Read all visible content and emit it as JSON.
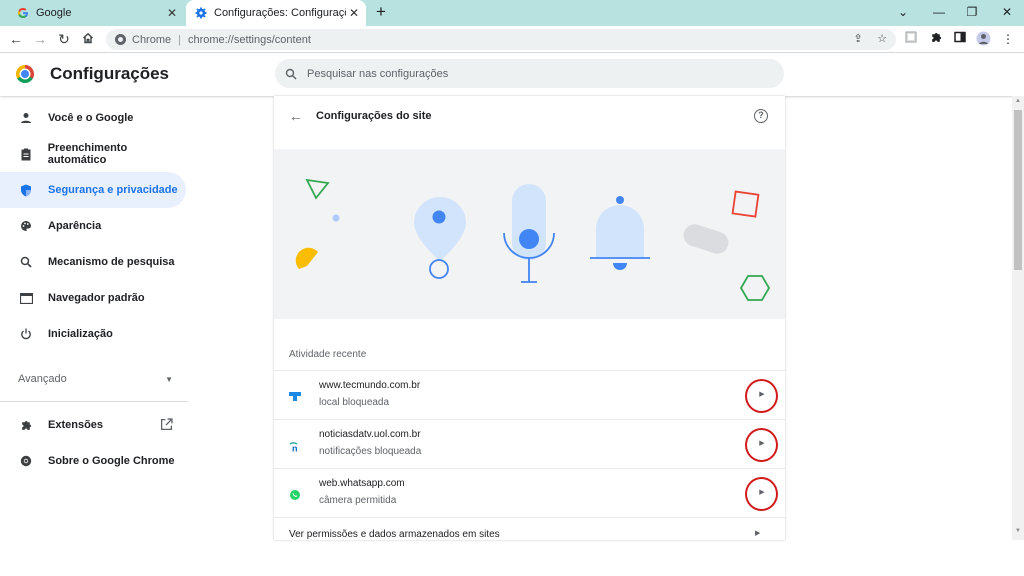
{
  "tabs": [
    {
      "title": "Google",
      "favicon": "google-g-icon"
    },
    {
      "title": "Configurações: Configurações do site",
      "favicon": "settings-gear-icon"
    }
  ],
  "omnibox": {
    "chip": "Chrome",
    "url": "chrome://settings/content"
  },
  "header": {
    "title": "Configurações",
    "search_placeholder": "Pesquisar nas configurações"
  },
  "sidebar": {
    "items": [
      {
        "label": "Você e o Google",
        "icon": "person-icon"
      },
      {
        "label": "Preenchimento automático",
        "icon": "clipboard-icon"
      },
      {
        "label": "Segurança e privacidade",
        "icon": "shield-icon"
      },
      {
        "label": "Aparência",
        "icon": "palette-icon"
      },
      {
        "label": "Mecanismo de pesquisa",
        "icon": "search-icon"
      },
      {
        "label": "Navegador padrão",
        "icon": "browser-window-icon"
      },
      {
        "label": "Inicialização",
        "icon": "power-icon"
      }
    ],
    "advanced": "Avançado",
    "extensions": "Extensões",
    "about": "Sobre o Google Chrome"
  },
  "main": {
    "title": "Configurações do site",
    "recent_heading": "Atividade recente",
    "recent": [
      {
        "host": "www.tecmundo.com.br",
        "permission": "local bloqueada"
      },
      {
        "host": "noticiasdatv.uol.com.br",
        "permission": "notificações bloqueada"
      },
      {
        "host": "web.whatsapp.com",
        "permission": "câmera permitida"
      }
    ],
    "permissions_link": "Ver permissões e dados armazenados em sites"
  },
  "colors": {
    "accent": "#1a73e8",
    "active_bg": "#e8f0fe",
    "annotation_circle": "#d11b1b",
    "tab_strip": "#b7e2e0"
  }
}
